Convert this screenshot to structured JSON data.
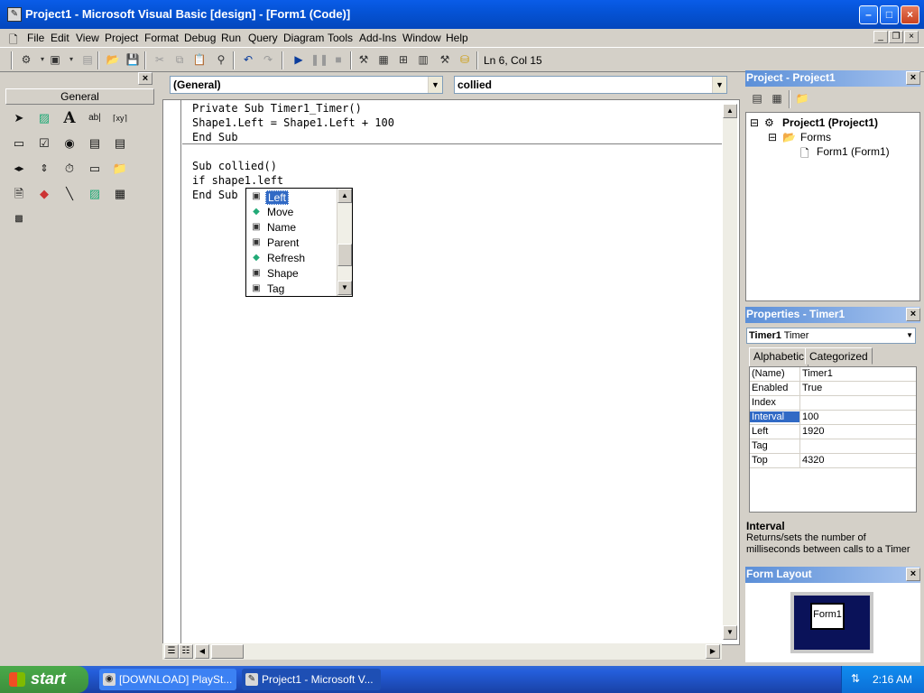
{
  "window": {
    "title": "Project1 - Microsoft Visual Basic [design] - [Form1 (Code)]",
    "min_label": "–",
    "max_label": "□",
    "close_label": "×"
  },
  "menu": {
    "items": [
      "File",
      "Edit",
      "View",
      "Project",
      "Format",
      "Debug",
      "Run",
      "Query",
      "Diagram",
      "Tools",
      "Add-Ins",
      "Window",
      "Help"
    ],
    "mdi_min": "_",
    "mdi_restore": "❐",
    "mdi_close": "×"
  },
  "toolbar": {
    "status": "Ln 6, Col 15"
  },
  "toolbox": {
    "close_label": "×",
    "tab_label": "General"
  },
  "code": {
    "object_combo": "(General)",
    "proc_combo": "collied",
    "lines": [
      "Private Sub Timer1_Timer()",
      "Shape1.Left = Shape1.Left + 100",
      "End Sub",
      "Sub collied()",
      "if shape1.left",
      "End Sub"
    ]
  },
  "autocomplete": {
    "items": [
      {
        "label": "Left",
        "icon": "property-icon",
        "selected": true
      },
      {
        "label": "Move",
        "icon": "method-icon",
        "selected": false
      },
      {
        "label": "Name",
        "icon": "property-icon",
        "selected": false
      },
      {
        "label": "Parent",
        "icon": "property-icon",
        "selected": false
      },
      {
        "label": "Refresh",
        "icon": "method-icon",
        "selected": false
      },
      {
        "label": "Shape",
        "icon": "property-icon",
        "selected": false
      },
      {
        "label": "Tag",
        "icon": "property-icon",
        "selected": false
      }
    ]
  },
  "project": {
    "title": "Project - Project1",
    "close_label": "×",
    "tree": {
      "root": "Project1 (Project1)",
      "folder": "Forms",
      "form": "Form1 (Form1)"
    }
  },
  "properties": {
    "title": "Properties - Timer1",
    "close_label": "×",
    "object_name": "Timer1",
    "object_type": "Timer",
    "tabs": [
      "Alphabetic",
      "Categorized"
    ],
    "rows": [
      {
        "name": "(Name)",
        "value": "Timer1"
      },
      {
        "name": "Enabled",
        "value": "True"
      },
      {
        "name": "Index",
        "value": ""
      },
      {
        "name": "Interval",
        "value": "100"
      },
      {
        "name": "Left",
        "value": "1920"
      },
      {
        "name": "Tag",
        "value": ""
      },
      {
        "name": "Top",
        "value": "4320"
      }
    ],
    "selected_row": 3,
    "desc_title": "Interval",
    "desc_text": "Returns/sets the number of milliseconds between calls to a Timer"
  },
  "form_layout": {
    "title": "Form Layout",
    "close_label": "×",
    "form_label": "Form1"
  },
  "taskbar": {
    "start_label": "start",
    "items": [
      {
        "label": "[DOWNLOAD] PlaySt..."
      },
      {
        "label": "Project1 - Microsoft V..."
      }
    ],
    "clock": "2:16 AM"
  }
}
